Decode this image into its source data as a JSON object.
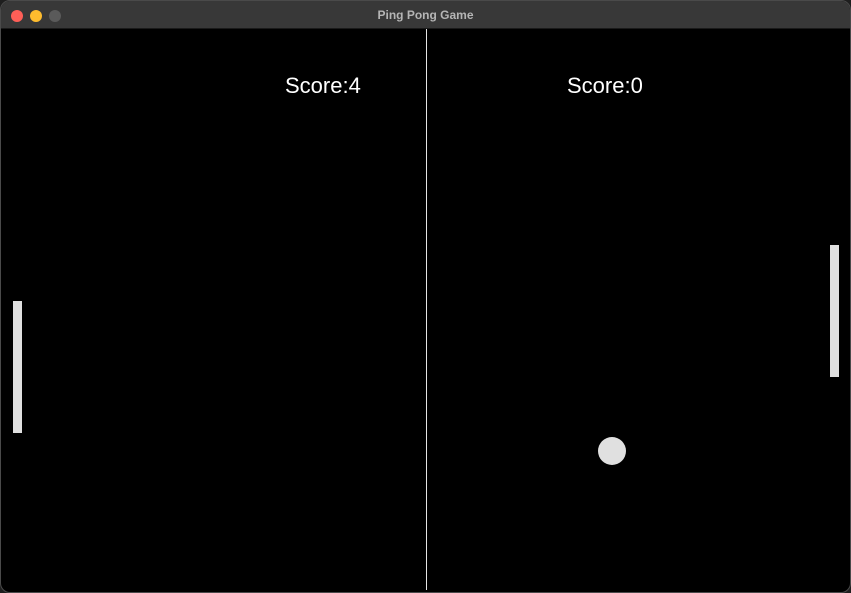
{
  "window": {
    "title": "Ping Pong Game",
    "controls": [
      "close",
      "minimize",
      "zoom"
    ]
  },
  "game": {
    "left_score_text": "Score:4",
    "right_score_text": "Score:0",
    "left_score": 4,
    "right_score": 0
  },
  "colors": {
    "court": "#000000",
    "foreground": "#e0e0e0",
    "text": "#ffffff",
    "titlebar": "#383838"
  }
}
